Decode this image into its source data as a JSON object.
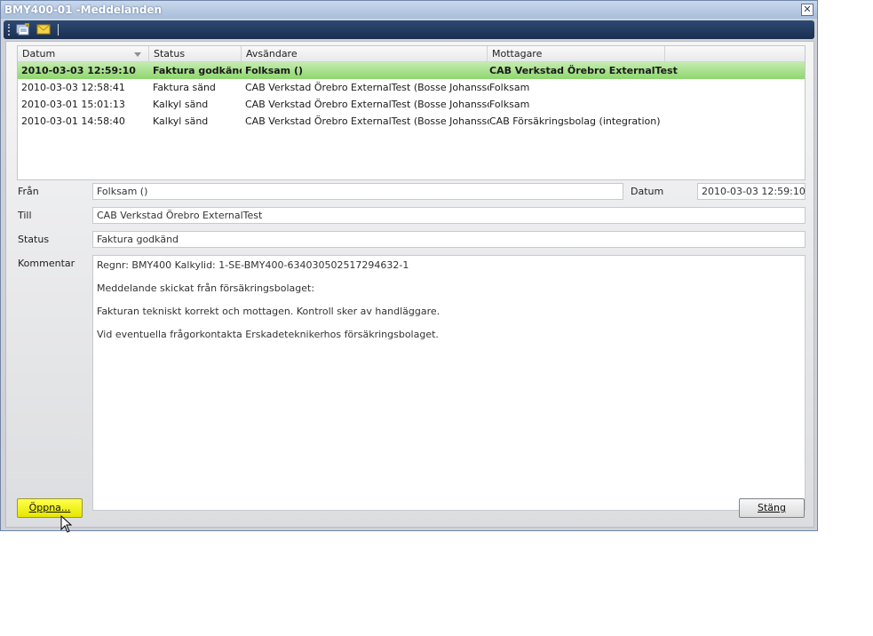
{
  "window": {
    "title": "BMY400-01 -Meddelanden",
    "close_glyph": "✕"
  },
  "toolbar": {
    "icons": [
      "open-message-icon",
      "envelope-icon"
    ]
  },
  "grid": {
    "columns": [
      "Datum",
      "Status",
      "Avsändare",
      "Mottagare"
    ],
    "rows": [
      [
        "2010-03-03 12:59:10",
        "Faktura godkänd",
        "Folksam ()",
        "CAB Verkstad Örebro ExternalTest"
      ],
      [
        "2010-03-03 12:58:41",
        "Faktura sänd",
        "CAB Verkstad Örebro ExternalTest  (Bosse Johansson)",
        "Folksam"
      ],
      [
        "2010-03-01 15:01:13",
        "Kalkyl sänd",
        "CAB Verkstad Örebro ExternalTest  (Bosse Johansson)",
        "Folksam"
      ],
      [
        "2010-03-01 14:58:40",
        "Kalkyl sänd",
        "CAB Verkstad Örebro ExternalTest  (Bosse Johansson)",
        "CAB Försäkringsbolag (integration)"
      ]
    ],
    "selected_row": 0,
    "selected_color": "#8ed66e"
  },
  "details": {
    "from_label": "Från",
    "from_value": "Folksam ()",
    "date_label": "Datum",
    "date_value": "2010-03-03 12:59:10",
    "to_label": "Till",
    "to_value": "CAB Verkstad Örebro ExternalTest",
    "status_label": "Status",
    "status_value": "Faktura godkänd",
    "comment_label": "Kommentar",
    "comment_lines": [
      "Regnr: BMY400     Kalkylid: 1-SE-BMY400-634030502517294632-1",
      "",
      "Meddelande skickat från försäkringsbolaget:",
      "",
      "Fakturan tekniskt korrekt och mottagen. Kontroll sker av handläggare.",
      "",
      "Vid eventuella frågorkontakta Erskadeteknikerhos försäkringsbolaget."
    ]
  },
  "buttons": {
    "open_label": "Öppna...",
    "open_color": "#ffff00",
    "close_label": "Stäng"
  }
}
